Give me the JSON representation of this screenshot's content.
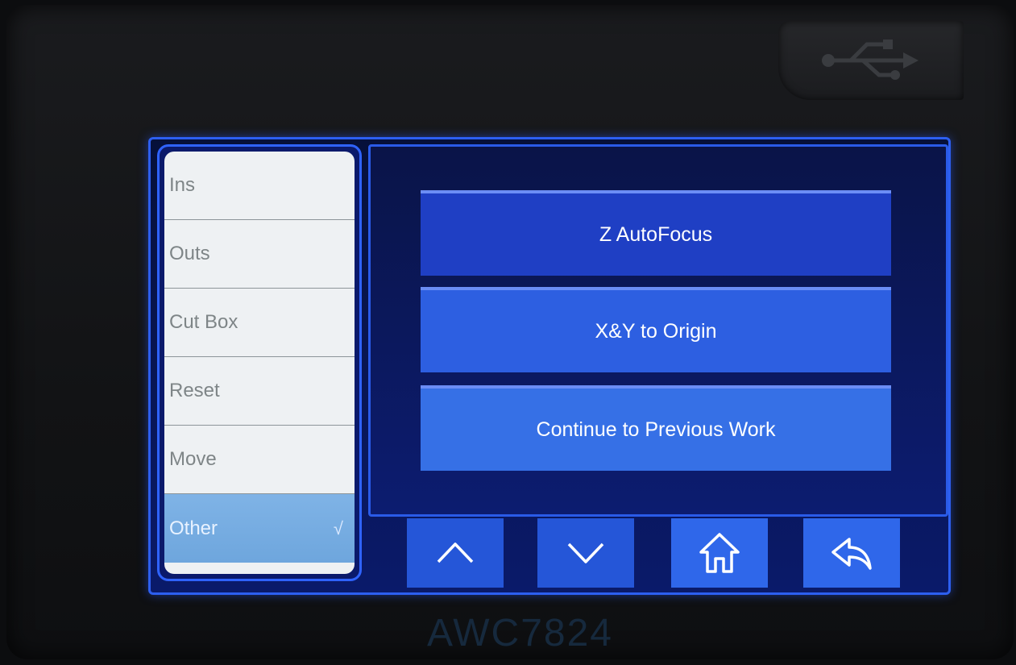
{
  "device": {
    "model_label": "AWC7824"
  },
  "sidebar": {
    "items": [
      {
        "label": "Ins"
      },
      {
        "label": "Outs"
      },
      {
        "label": "Cut Box"
      },
      {
        "label": "Reset"
      },
      {
        "label": "Move"
      },
      {
        "label": "Other",
        "selected": true,
        "check_mark": "√"
      }
    ]
  },
  "main": {
    "buttons": [
      {
        "label": "Z AutoFocus"
      },
      {
        "label": "X&Y to Origin"
      },
      {
        "label": "Continue to Previous Work"
      }
    ]
  },
  "navbar": {
    "icons": [
      "chevron-up-icon",
      "chevron-down-icon",
      "home-icon",
      "back-icon"
    ]
  },
  "colors": {
    "screen_border": "#2d5ff0",
    "button_blue": "#2d5fe1",
    "selected_item": "#7fb3e6",
    "menu_bg": "#eef1f3"
  }
}
